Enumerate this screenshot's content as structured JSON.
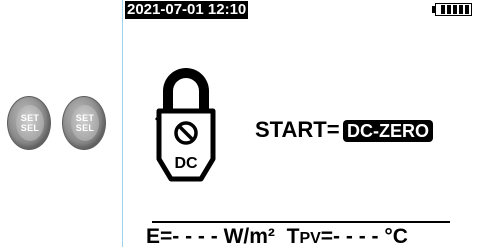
{
  "buttons": [
    {
      "line1": "SET",
      "line2": "SEL"
    },
    {
      "line1": "SET",
      "line2": "SEL"
    }
  ],
  "status_bar": {
    "datetime": "2021-07-01 12:10",
    "battery_icon": "battery-full-icon",
    "battery_level": 1.0
  },
  "clamp_meter": {
    "icon": "clamp-meter-icon",
    "label": "DC"
  },
  "start": {
    "label": "START=",
    "value": "DC-ZERO"
  },
  "readout": {
    "e_label": "E=",
    "e_value": "- - - -",
    "e_unit": "W/m²",
    "t_label_main": "T",
    "t_label_sub": "PV",
    "t_eq": "=",
    "t_value": "- - - -",
    "t_unit": "°C"
  },
  "colors": {
    "screen_border": "#9ed3e8",
    "button": "#8a8a8a"
  }
}
